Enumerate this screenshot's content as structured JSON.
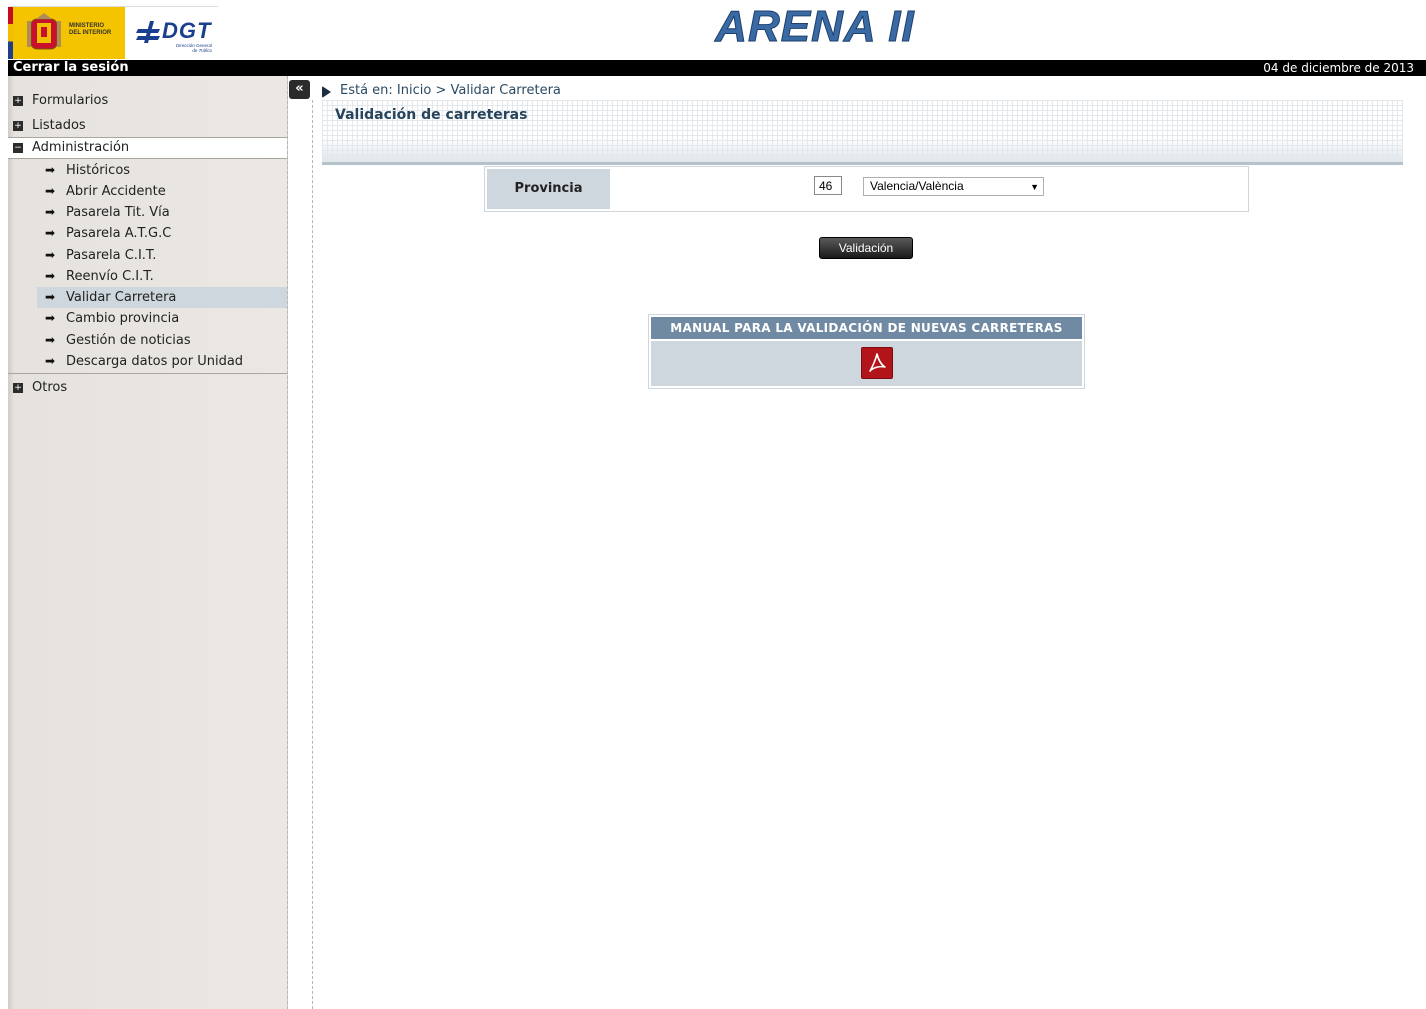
{
  "header": {
    "ministerio_text": "MINISTERIO\nDEL INTERIOR",
    "dgt_text": "DGT",
    "dgt_sub": "Dirección General\nde Tráfico",
    "app_title": "ARENA II"
  },
  "topbar": {
    "logout": "Cerrar la sesión",
    "date": "04 de diciembre de 2013"
  },
  "sidebar": {
    "collapse": "«",
    "sections": {
      "formularios": "Formularios",
      "listados": "Listados",
      "administracion": "Administración",
      "otros": "Otros"
    },
    "admin_items": [
      "Históricos",
      "Abrir Accidente",
      "Pasarela Tit. Vía",
      "Pasarela A.T.G.C",
      "Pasarela C.I.T.",
      "Reenvío C.I.T.",
      "Validar Carretera",
      "Cambio provincia",
      "Gestión de noticias",
      "Descarga datos por Unidad"
    ],
    "active_item": "Validar Carretera"
  },
  "content": {
    "breadcrumb": "Está en: Inicio > Validar Carretera",
    "title": "Validación de carreteras",
    "provincia_label": "Provincia",
    "provincia_code": "46",
    "provincia_value": "Valencia/València",
    "validate_button": "Validación",
    "manual_title": "MANUAL PARA LA VALIDACIÓN DE NUEVAS CARRETERAS"
  },
  "icons": {
    "collapse": "double-chevron-left-icon",
    "section_plus": "plus-box-icon",
    "section_minus": "minus-box-icon",
    "item_arrow": "arrow-right-icon",
    "breadcrumb": "breadcrumb-arrow-icon",
    "pdf": "pdf-icon"
  },
  "colors": {
    "title_blue": "#3a6aa4",
    "active_item_bg": "#cdd7dd",
    "manual_header": "#6f8aa2",
    "pdf_red": "#b3141a"
  }
}
